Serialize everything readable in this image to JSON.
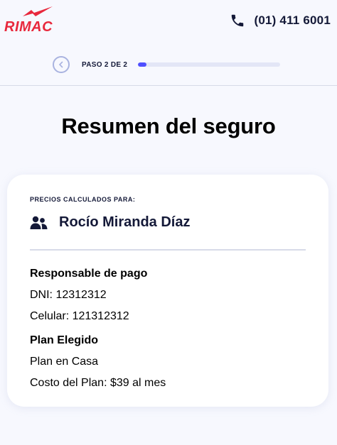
{
  "header": {
    "brand": "RIMAC",
    "phone": "(01) 411 6001",
    "phone_icon": "phone-icon"
  },
  "stepper": {
    "label": "PASO 2 DE 2",
    "progress": 0.06
  },
  "page": {
    "title": "Resumen del seguro"
  },
  "card": {
    "eyebrow": "PRECIOS CALCULADOS PARA:",
    "insured_name": "Rocío Miranda Díaz",
    "payer_section_title": "Responsable de pago",
    "dni": "DNI: 12312312",
    "cellphone": "Celular: 121312312",
    "plan_section_title": "Plan Elegido",
    "plan_name": "Plan en Casa",
    "plan_cost": "Costo del Plan: $39 al mes"
  },
  "colors": {
    "brand_red": "#e8283c",
    "accent_blue": "#4f4fff",
    "text_dark": "#141938",
    "background": "#f7f8fe"
  }
}
